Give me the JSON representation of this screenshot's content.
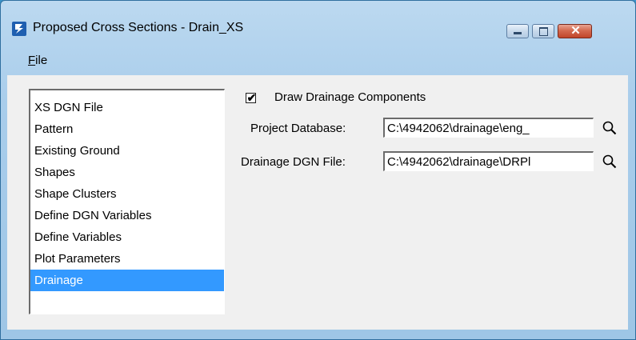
{
  "window": {
    "title": "Proposed Cross Sections - Drain_XS",
    "app_icon": "bentley-b-icon"
  },
  "menu": {
    "file_label": "File",
    "file_mnemonic": "F",
    "file_rest": "ile"
  },
  "list": {
    "items": [
      "XS DGN File",
      "Pattern",
      "Existing Ground",
      "Shapes",
      "Shape Clusters",
      "Define DGN Variables",
      "Define Variables",
      "Plot Parameters",
      "Drainage"
    ],
    "selected": "Drainage",
    "selected_color": "#3399ff"
  },
  "drainage_panel": {
    "checkbox_label": "Draw Drainage Components",
    "checkbox_checked": true,
    "project_db_label": "Project Database:",
    "project_db_value": "C:\\4942062\\drainage\\eng_",
    "drainage_dgn_label": "Drainage DGN File:",
    "drainage_dgn_value": "C:\\4942062\\drainage\\DRPl",
    "browse_icon": "magnifier-icon"
  },
  "colors": {
    "desktop": "#3a93c9",
    "close_button": "#c7472b"
  }
}
